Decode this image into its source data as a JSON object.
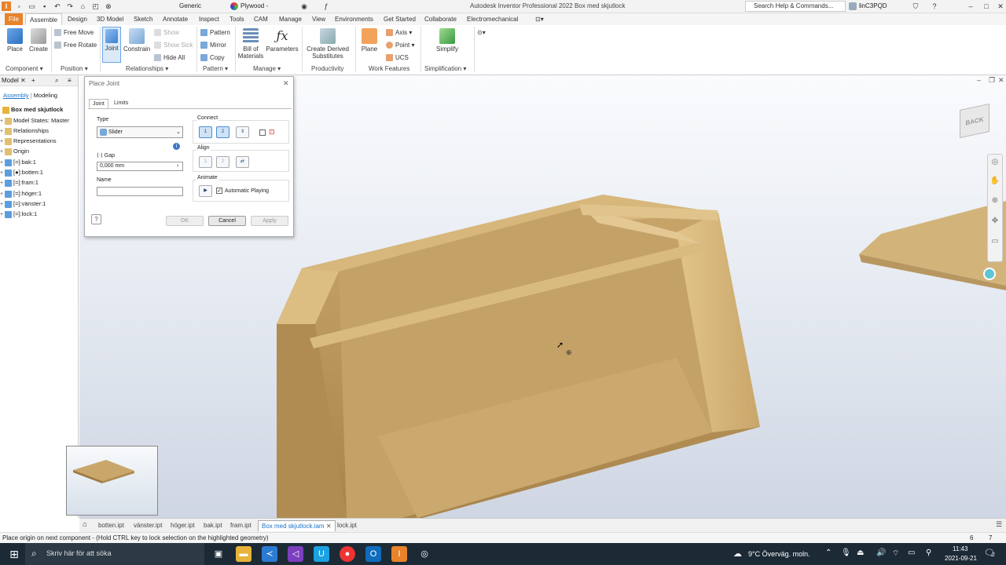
{
  "window": {
    "title": "Autodesk Inventor Professional 2022   Box med skjutlock",
    "material": "Generic",
    "appearance": "Plywood -",
    "search_placeholder": "Search Help & Commands...",
    "user": "linC3PQD"
  },
  "ribbon_tabs": [
    "File",
    "Assemble",
    "Design",
    "3D Model",
    "Sketch",
    "Annotate",
    "Inspect",
    "Tools",
    "CAM",
    "Manage",
    "View",
    "Environments",
    "Get Started",
    "Collaborate",
    "Electromechanical"
  ],
  "ribbon": {
    "component": {
      "place": "Place",
      "create": "Create",
      "title": "Component"
    },
    "position": {
      "free_move": "Free Move",
      "free_rotate": "Free Rotate",
      "title": "Position"
    },
    "relationships": {
      "joint": "Joint",
      "constrain": "Constrain",
      "show": "Show",
      "show_sick": "Show Sick",
      "hide_all": "Hide All",
      "title": "Relationships"
    },
    "pattern": {
      "pattern": "Pattern",
      "mirror": "Mirror",
      "copy": "Copy",
      "title": "Pattern"
    },
    "manage": {
      "bom": "Bill of Materials",
      "parameters": "Parameters",
      "title": "Manage"
    },
    "productivity": {
      "derived": "Create Derived Substitutes",
      "title": "Productivity"
    },
    "work_features": {
      "plane": "Plane",
      "axis": "Axis",
      "point": "Point",
      "ucs": "UCS",
      "title": "Work Features"
    },
    "simplification": {
      "simplify": "Simplify",
      "title": "Simplification"
    }
  },
  "browser": {
    "title": "Model",
    "tabs": [
      "Assembly",
      "Modeling"
    ],
    "root": "Box med skjutlock",
    "items": [
      "Model States: Master",
      "Relationships",
      "Representations",
      "Origin",
      "[=]:bak:1",
      "[●]:botten:1",
      "[=]:fram:1",
      "[=]:höger:1",
      "[=]:vänster:1",
      "[=]:lock:1"
    ]
  },
  "dialog": {
    "title": "Place Joint",
    "tabs": [
      "Joint",
      "Limits"
    ],
    "type_label": "Type",
    "type_value": "Slider",
    "gap_label": "Gap",
    "gap_value": "0,000 mm",
    "name_label": "Name",
    "name_value": "",
    "connect_label": "Connect",
    "align_label": "Align",
    "animate_label": "Animate",
    "auto_play": "Automatic Playing",
    "ok": "OK",
    "cancel": "Cancel",
    "apply": "Apply"
  },
  "viewcube": {
    "face": "BACK"
  },
  "doc_tabs": [
    "botten.ipt",
    "vänster.ipt",
    "höger.ipt",
    "bak.ipt",
    "fram.ipt",
    "Box med skjutlock.iam",
    "lock.ipt"
  ],
  "doc_active": "Box med skjutlock.iam",
  "status": {
    "message": "Place origin on next component - (Hold CTRL key to lock selection on the highlighted geometry)",
    "n1": "6",
    "n2": "7"
  },
  "taskbar": {
    "search": "Skriv här för att söka",
    "weather": "9°C  Överväg. moln.",
    "time": "11:43",
    "date": "2021-09-21",
    "notifications": "2"
  },
  "colors": {
    "accent": "#e8832a",
    "selection": "#4a8ad4",
    "taskbar": "#1c2a36",
    "wood": "#c8a46a"
  }
}
